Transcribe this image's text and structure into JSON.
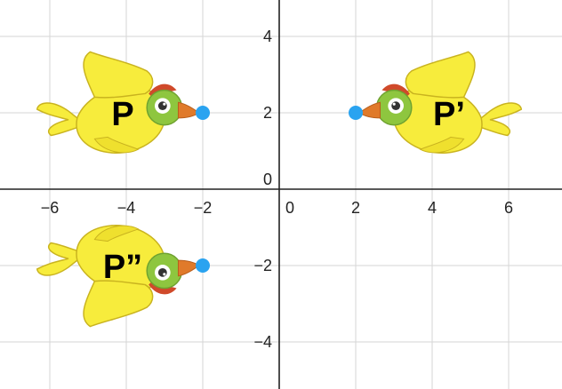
{
  "grid": {
    "x_range": [
      -7,
      7
    ],
    "y_range": [
      -5,
      5
    ],
    "x_ticks": [
      -6,
      -4,
      -2,
      2,
      4,
      6
    ],
    "y_ticks": [
      -4,
      -2,
      2,
      4
    ],
    "origin_x_label": "0",
    "origin_y_label": "0"
  },
  "birds": [
    {
      "label": "P",
      "beak": [
        -2,
        2
      ],
      "facing": "right",
      "flipped": false
    },
    {
      "label": "P’",
      "beak": [
        2,
        2
      ],
      "facing": "left",
      "flipped": false
    },
    {
      "label": "P”",
      "beak": [
        -2,
        -2
      ],
      "facing": "right",
      "flipped": true
    }
  ],
  "colors": {
    "point": "#2aa3f0",
    "body": "#f7ec3c",
    "body_outline": "#c9b31f",
    "head": "#8ec63f",
    "beak": "#e07a2a",
    "crest": "#d04a2a"
  }
}
